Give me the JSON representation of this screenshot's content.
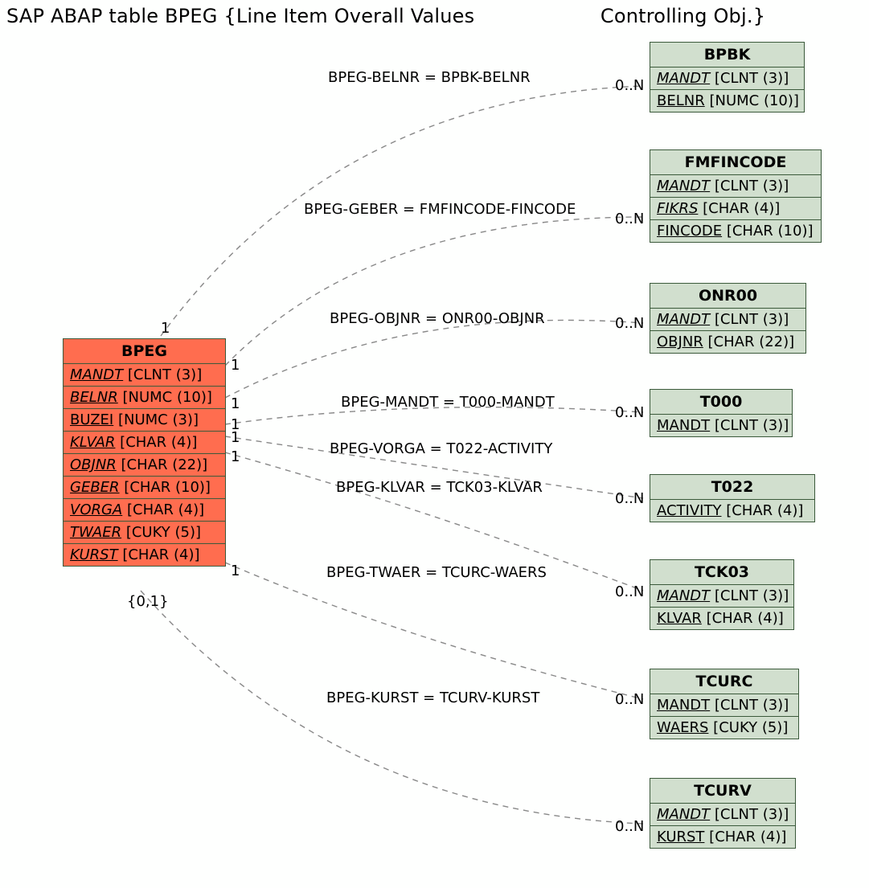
{
  "title": "SAP ABAP table BPEG {Line Item Overall Values                    Controlling Obj.}",
  "main_entity": {
    "name": "BPEG",
    "note": "{0,1}",
    "fields": [
      {
        "name": "MANDT",
        "type": "[CLNT (3)]",
        "key": true
      },
      {
        "name": "BELNR",
        "type": "[NUMC (10)]",
        "key": true
      },
      {
        "name": "BUZEI",
        "type": "[NUMC (3)]",
        "key": false
      },
      {
        "name": "KLVAR",
        "type": "[CHAR (4)]",
        "key": true
      },
      {
        "name": "OBJNR",
        "type": "[CHAR (22)]",
        "key": true
      },
      {
        "name": "GEBER",
        "type": "[CHAR (10)]",
        "key": true
      },
      {
        "name": "VORGA",
        "type": "[CHAR (4)]",
        "key": true
      },
      {
        "name": "TWAER",
        "type": "[CUKY (5)]",
        "key": true
      },
      {
        "name": "KURST",
        "type": "[CHAR (4)]",
        "key": true
      }
    ]
  },
  "ref_entities": [
    {
      "id": "bpbk",
      "name": "BPBK",
      "fields": [
        {
          "name": "MANDT",
          "type": "[CLNT (3)]",
          "key": true
        },
        {
          "name": "BELNR",
          "type": "[NUMC (10)]",
          "key": false
        }
      ]
    },
    {
      "id": "fmfincode",
      "name": "FMFINCODE",
      "fields": [
        {
          "name": "MANDT",
          "type": "[CLNT (3)]",
          "key": true
        },
        {
          "name": "FIKRS",
          "type": "[CHAR (4)]",
          "key": true
        },
        {
          "name": "FINCODE",
          "type": "[CHAR (10)]",
          "key": false
        }
      ]
    },
    {
      "id": "onr00",
      "name": "ONR00",
      "fields": [
        {
          "name": "MANDT",
          "type": "[CLNT (3)]",
          "key": true
        },
        {
          "name": "OBJNR",
          "type": "[CHAR (22)]",
          "key": false
        }
      ]
    },
    {
      "id": "t000",
      "name": "T000",
      "fields": [
        {
          "name": "MANDT",
          "type": "[CLNT (3)]",
          "key": false
        }
      ]
    },
    {
      "id": "t022",
      "name": "T022",
      "fields": [
        {
          "name": "ACTIVITY",
          "type": "[CHAR (4)]",
          "key": false
        }
      ]
    },
    {
      "id": "tck03",
      "name": "TCK03",
      "fields": [
        {
          "name": "MANDT",
          "type": "[CLNT (3)]",
          "key": true
        },
        {
          "name": "KLVAR",
          "type": "[CHAR (4)]",
          "key": false
        }
      ]
    },
    {
      "id": "tcurc",
      "name": "TCURC",
      "fields": [
        {
          "name": "MANDT",
          "type": "[CLNT (3)]",
          "key": false
        },
        {
          "name": "WAERS",
          "type": "[CUKY (5)]",
          "key": false
        }
      ]
    },
    {
      "id": "tcurv",
      "name": "TCURV",
      "fields": [
        {
          "name": "MANDT",
          "type": "[CLNT (3)]",
          "key": true
        },
        {
          "name": "KURST",
          "type": "[CHAR (4)]",
          "key": false
        }
      ]
    }
  ],
  "relations": [
    {
      "id": "r1",
      "label": "BPEG-BELNR = BPBK-BELNR",
      "src_card": "1",
      "dst_card": "0..N"
    },
    {
      "id": "r2",
      "label": "BPEG-GEBER = FMFINCODE-FINCODE",
      "src_card": "1",
      "dst_card": "0..N"
    },
    {
      "id": "r3",
      "label": "BPEG-OBJNR = ONR00-OBJNR",
      "src_card": "1",
      "dst_card": "0..N"
    },
    {
      "id": "r4",
      "label": "BPEG-MANDT = T000-MANDT",
      "src_card": "1",
      "dst_card": "0..N"
    },
    {
      "id": "r5",
      "label": "BPEG-VORGA = T022-ACTIVITY",
      "src_card": "1",
      "dst_card": ""
    },
    {
      "id": "r6",
      "label": "BPEG-KLVAR = TCK03-KLVAR",
      "src_card": "1",
      "dst_card": "0..N"
    },
    {
      "id": "r7",
      "label": "BPEG-TWAER = TCURC-WAERS",
      "src_card": "1",
      "dst_card": "0..N"
    },
    {
      "id": "r8",
      "label": "BPEG-KURST = TCURV-KURST",
      "src_card": "1",
      "dst_card": "0..N"
    }
  ]
}
